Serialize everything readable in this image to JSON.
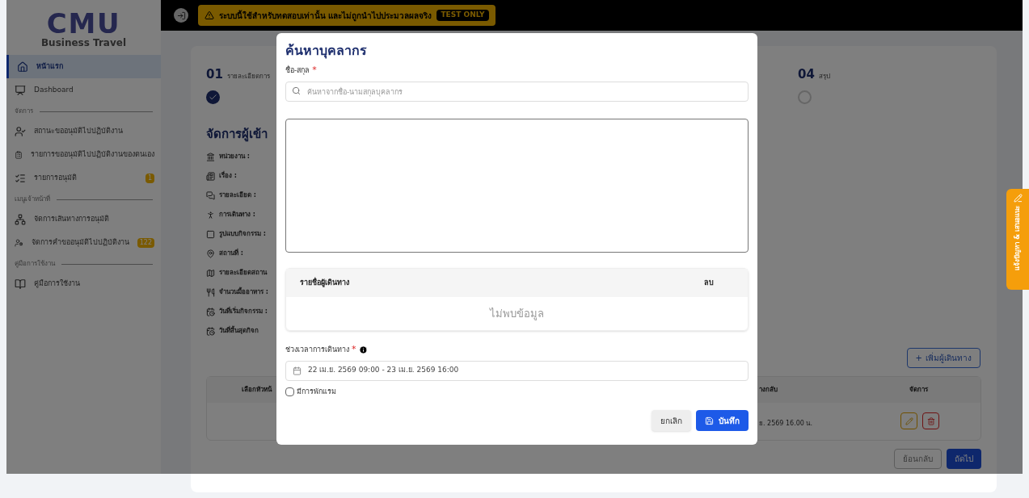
{
  "sidebar": {
    "logo": "CMU",
    "subtitle": "Business Travel",
    "sections": [
      {
        "items": [
          {
            "label": "หน้าแรก",
            "selected": true
          },
          {
            "label": "Dashboard",
            "selected": false
          }
        ]
      },
      {
        "title": "จัดการ",
        "items": [
          {
            "label": "สถานะขออนุมัติไปปฏิบัติงาน",
            "selected": false
          },
          {
            "label": "รายการขออนุมัติไปปฏิบัติงานของตนเอง",
            "selected": false
          },
          {
            "label": "รายการอนุมัติ",
            "selected": false,
            "badge": "1"
          }
        ]
      },
      {
        "title": "เมนูเจ้าหน้าที่",
        "items": [
          {
            "label": "จัดการเส้นทางการอนุมัติ",
            "selected": false
          },
          {
            "label": "จัดการคำขออนุมัติไปปฏิบัติงาน",
            "selected": false,
            "badge": "122"
          }
        ]
      },
      {
        "title": "คู่มือการใช้งาน",
        "items": [
          {
            "label": "คู่มือการใช้งาน",
            "selected": false
          }
        ]
      }
    ]
  },
  "top_bar": {
    "banner": "ระบบนี้ใช้สำหรับทดสอบเท่านั้น และไม่ถูกนำไปประมวลผลจริง",
    "badge": "TEST ONLY"
  },
  "steps": [
    {
      "number": "01",
      "label": "รายละเอียดการ",
      "completed": true
    },
    {
      "number": "04",
      "label": "สรุป",
      "completed": false
    }
  ],
  "section_title": "จัดการผู้เข้า",
  "fields": [
    {
      "label": "หน่วยงาน :"
    },
    {
      "label": "เรื่อง :"
    },
    {
      "label": "รายละเอียด :"
    },
    {
      "label": "การเดินทาง :"
    },
    {
      "label": "รูปแบบกิจกรรม :"
    },
    {
      "label": "สถานที่ :"
    },
    {
      "label": "รายละเอียดสถาน"
    },
    {
      "label": "จำนวนมื้ออาหาร :"
    },
    {
      "label": "วันที่เริ่มกิจกรรม :"
    },
    {
      "label": "วันที่สิ้นสุดกิจก"
    }
  ],
  "add_button": {
    "icon": "+",
    "label": "เพิ่มผู้เดินทาง"
  },
  "table": {
    "columns": [
      "เลือกหัวหน้",
      "างกลับ",
      "จัดการ"
    ],
    "rows": [
      {
        "column_2": "ย. 2569  16.00 น."
      }
    ]
  },
  "footer_buttons": [
    {
      "label": "ย้อนกลับ",
      "kind": "outline"
    },
    {
      "label": "ถัดไป",
      "kind": "primary"
    }
  ],
  "feedback_tab": "แจ้งปัญหา & เสนอแนะ",
  "modal": {
    "title": "ค้นหาบุคลากร",
    "name_label": "ชื่อ-สกุล",
    "name_required": "*",
    "search_placeholder": "ค้นหาจากชื่อ-นามสกุลบุคลากร",
    "travelers": {
      "columns": [
        "รายชื่อผู้เดินทาง",
        "ลบ"
      ],
      "empty": "ไม่พบข้อมูล"
    },
    "period_label": "ช่วงเวลาการเดินทาง",
    "period_required": "*",
    "period_value": "22 เม.ย. 2569 09:00 - 23 เม.ย. 2569 16:00",
    "overnight": {
      "label": "มีการพักแรม",
      "checked": false
    },
    "buttons": [
      {
        "label": "ยกเลิก",
        "kind": "secondary"
      },
      {
        "label": "บันทึก",
        "kind": "primary"
      }
    ]
  }
}
